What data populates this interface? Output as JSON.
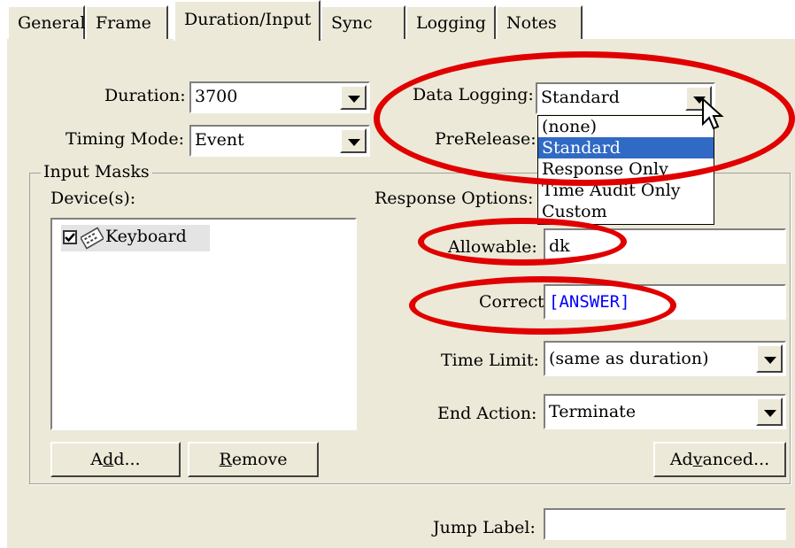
{
  "tabs": [
    {
      "label": "General"
    },
    {
      "label": "Frame"
    },
    {
      "label": "Duration/Input"
    },
    {
      "label": "Sync"
    },
    {
      "label": "Logging"
    },
    {
      "label": "Notes"
    }
  ],
  "duration": {
    "label": "Duration:",
    "value": "3700"
  },
  "timing_mode": {
    "label": "Timing Mode:",
    "value": "Event"
  },
  "data_logging": {
    "label": "Data Logging:",
    "value": "Standard",
    "options": [
      "(none)",
      "Standard",
      "Response Only",
      "Time Audit Only",
      "Custom"
    ],
    "selected_index": 1
  },
  "prerelease": {
    "label": "PreRelease:"
  },
  "input_masks": {
    "title": "Input Masks",
    "devices_label": "Device(s):",
    "devices": [
      {
        "name": "Keyboard",
        "checked": true
      }
    ],
    "add_button": {
      "pre": "A",
      "accel": "d",
      "post": "d..."
    },
    "remove_button": {
      "pre": "",
      "accel": "R",
      "post": "emove"
    },
    "response_options_label": "Response Options:",
    "allowable": {
      "label": "Allowable:",
      "value": "dk"
    },
    "correct": {
      "label": "Correct:",
      "value": "[ANSWER]"
    },
    "time_limit": {
      "label": "Time Limit:",
      "value": "(same as duration)"
    },
    "end_action": {
      "label": "End Action:",
      "value": "Terminate"
    },
    "advanced_button": {
      "pre": "Ad",
      "accel": "v",
      "post": "anced..."
    }
  },
  "jump_label": {
    "label": "Jump Label:",
    "value": ""
  },
  "colors": {
    "highlight": "#e00000",
    "selection": "#316ac5",
    "answer_text": "#0000ff",
    "panel": "#ece9d8"
  }
}
